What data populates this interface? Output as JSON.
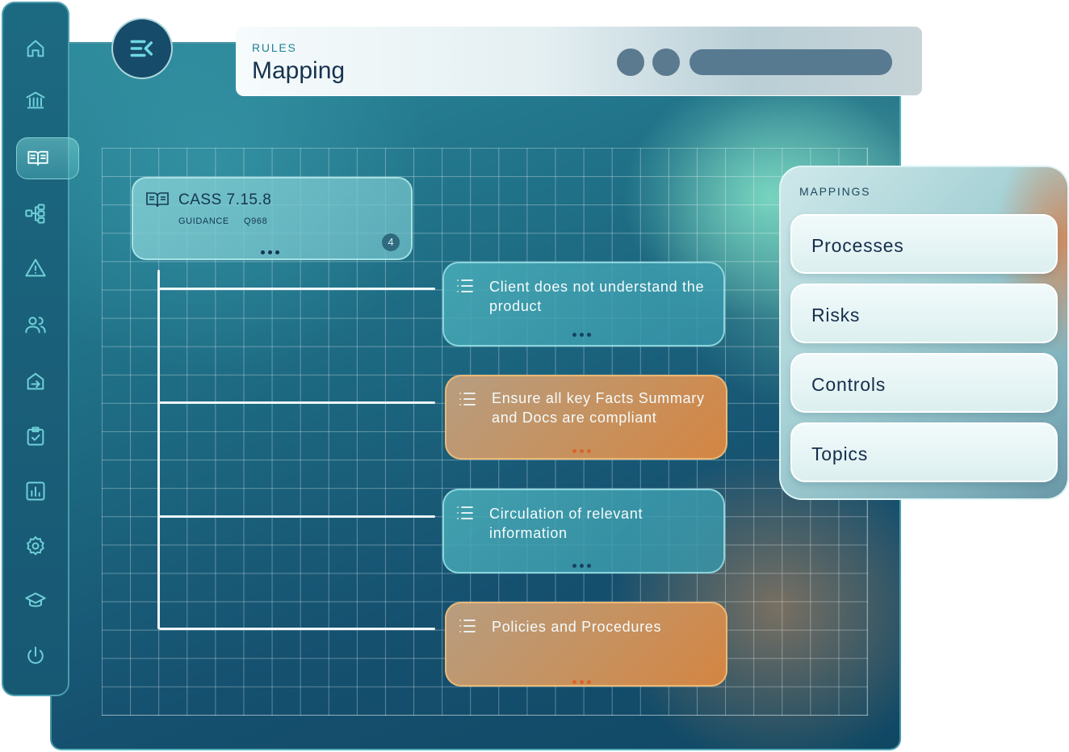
{
  "header": {
    "eyebrow": "RULES",
    "title": "Mapping"
  },
  "sidebar": {
    "items": [
      {
        "icon": "home-icon",
        "active": false
      },
      {
        "icon": "bank-icon",
        "active": false
      },
      {
        "icon": "book-icon",
        "active": true
      },
      {
        "icon": "workflow-icon",
        "active": false
      },
      {
        "icon": "warning-icon",
        "active": false
      },
      {
        "icon": "users-icon",
        "active": false
      },
      {
        "icon": "import-icon",
        "active": false
      },
      {
        "icon": "clipboard-check-icon",
        "active": false
      },
      {
        "icon": "bar-chart-icon",
        "active": false
      },
      {
        "icon": "settings-icon",
        "active": false
      },
      {
        "icon": "graduation-cap-icon",
        "active": false
      },
      {
        "icon": "power-icon",
        "active": false
      }
    ]
  },
  "rule": {
    "code": "CASS 7.15.8",
    "type": "GUIDANCE",
    "ref": "Q968",
    "count": "4"
  },
  "nodes": [
    {
      "label": "Client does not understand the product",
      "variant": "teal"
    },
    {
      "label": "Ensure all key Facts Summary and Docs are compliant",
      "variant": "orange"
    },
    {
      "label": "Circulation of relevant information",
      "variant": "teal"
    },
    {
      "label": "Policies and Procedures",
      "variant": "orange"
    }
  ],
  "mappings": {
    "heading": "MAPPINGS",
    "items": [
      "Processes",
      "Risks",
      "Controls",
      "Topics"
    ]
  },
  "colors": {
    "accent": "#6fd0d8",
    "teal_card": "#3c98aa",
    "orange_card": "#d48542",
    "text_dark": "#16334f"
  }
}
